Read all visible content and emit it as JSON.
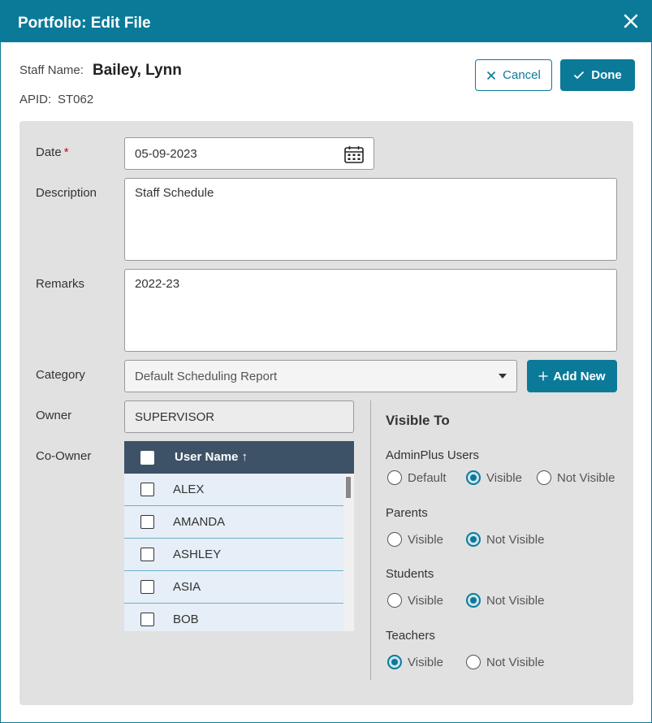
{
  "header": {
    "title": "Portfolio: Edit File",
    "close_icon": "close-icon"
  },
  "staff": {
    "name_label": "Staff Name:",
    "name": "Bailey, Lynn",
    "apid_label": "APID:",
    "apid": "ST062"
  },
  "actions": {
    "cancel_label": "Cancel",
    "done_label": "Done"
  },
  "form": {
    "date_label": "Date",
    "required_mark": "*",
    "date_value": "05-09-2023",
    "description_label": "Description",
    "description_value": "Staff Schedule",
    "remarks_label": "Remarks",
    "remarks_value": "2022-23",
    "category_label": "Category",
    "category_value": "Default Scheduling Report",
    "add_new_label": "Add New",
    "owner_label": "Owner",
    "owner_value": "SUPERVISOR",
    "coowner_label": "Co-Owner"
  },
  "coowner_table": {
    "column_header": "User Name ↑",
    "rows": [
      "ALEX",
      "AMANDA",
      "ASHLEY",
      "ASIA",
      "BOB"
    ]
  },
  "visible_to": {
    "title": "Visible To",
    "groups": [
      {
        "label": "AdminPlus Users",
        "options": [
          "Default",
          "Visible",
          "Not Visible"
        ],
        "selected": "Visible"
      },
      {
        "label": "Parents",
        "options": [
          "Visible",
          "Not Visible"
        ],
        "selected": "Not Visible"
      },
      {
        "label": "Students",
        "options": [
          "Visible",
          "Not Visible"
        ],
        "selected": "Not Visible"
      },
      {
        "label": "Teachers",
        "options": [
          "Visible",
          "Not Visible"
        ],
        "selected": "Visible"
      }
    ]
  },
  "colors": {
    "primary": "#0b7a99",
    "header_dark": "#3d5266",
    "panel_bg": "#e1e1e1",
    "required": "#d0021b"
  }
}
